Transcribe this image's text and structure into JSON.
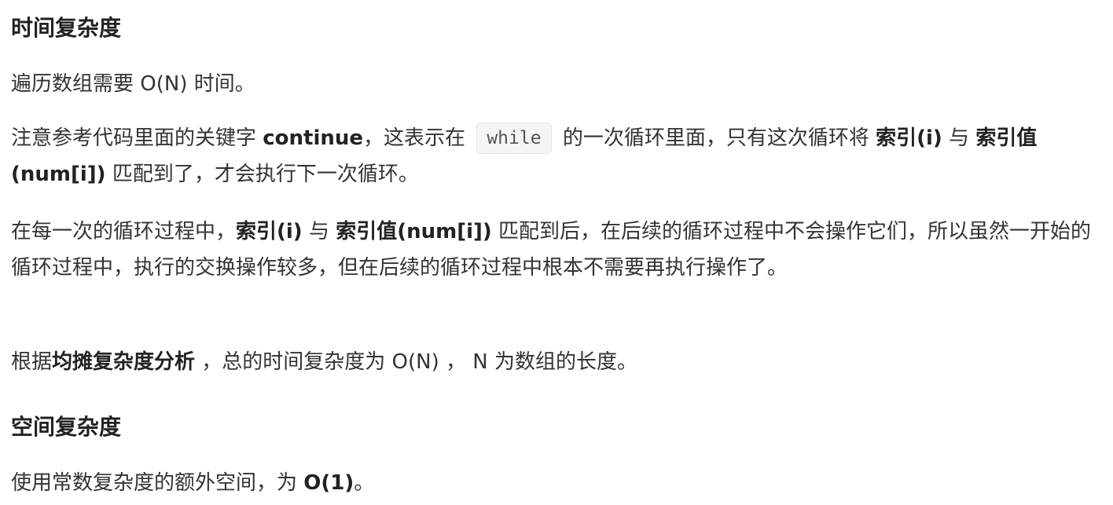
{
  "time_section": {
    "heading": "时间复杂度",
    "p1": "遍历数组需要 O(N) 时间。",
    "p2": {
      "t1": "注意参考代码里面的关键字 ",
      "b1": "continue",
      "t2": "，这表示在 ",
      "code": "while",
      "t3": " 的一次循环里面，只有这次循环将 ",
      "b2": "索引(i)",
      "t4": " 与 ",
      "b3": "索引值(num[i])",
      "t5": " 匹配到了，才会执行下一次循环。"
    },
    "p3": {
      "t1": "在每一次的循环过程中，",
      "b1": "索引(i)",
      "t2": " 与 ",
      "b2": "索引值(num[i])",
      "t3": " 匹配到后，在后续的循环过程中不会操作它们，所以虽然一开始的循环过程中，执行的交换操作较多，但在后续的循环过程中根本不需要再执行操作了。"
    },
    "p4": {
      "t1": "根据",
      "b1": "均摊复杂度分析",
      "t2": " ，总的时间复杂度为 O(N) ， N 为数组的长度。"
    }
  },
  "space_section": {
    "heading": "空间复杂度",
    "p1": {
      "t1": "使用常数复杂度的额外空间，为 ",
      "b1": "O(1)",
      "t2": "。"
    }
  }
}
